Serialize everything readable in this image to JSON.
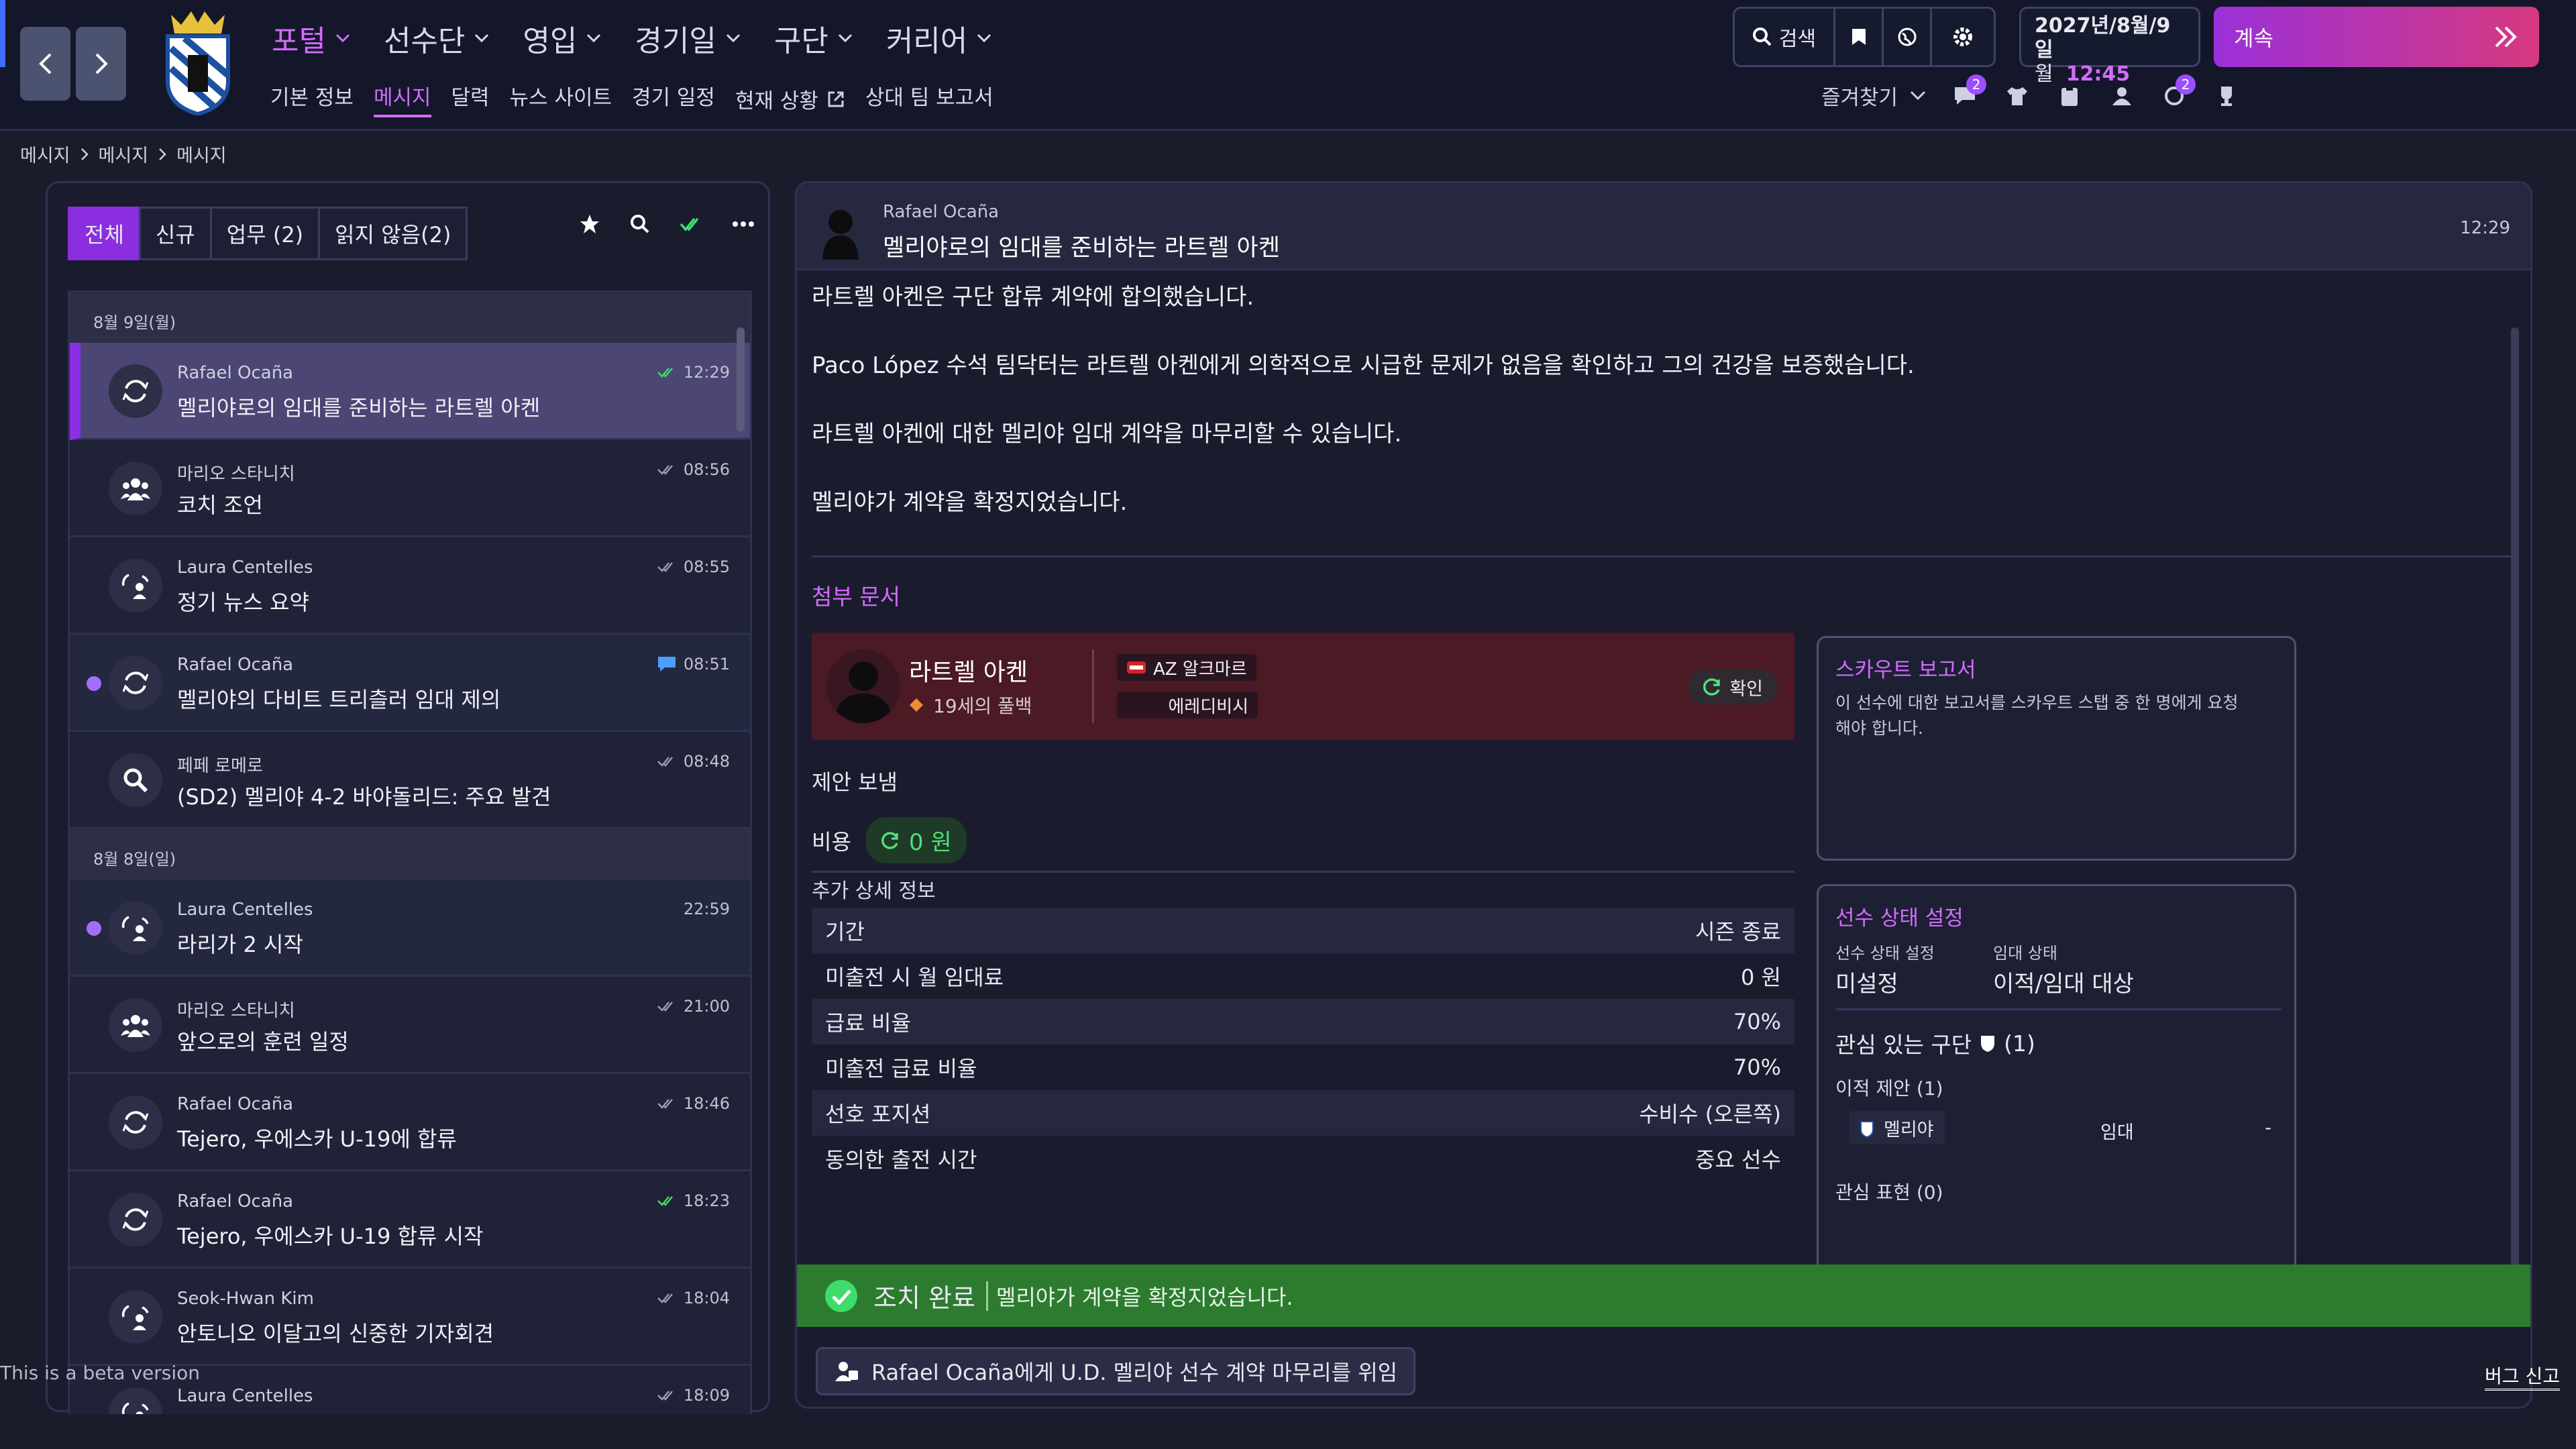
{
  "topbar": {
    "menu": [
      {
        "label": "포털",
        "active": true
      },
      {
        "label": "선수단"
      },
      {
        "label": "영입"
      },
      {
        "label": "경기일"
      },
      {
        "label": "구단"
      },
      {
        "label": "커리어"
      }
    ],
    "submenu": [
      "기본 정보",
      "메시지",
      "달력",
      "뉴스 사이트",
      "경기 일정",
      "현재 상황",
      "상대 팀 보고서"
    ],
    "submenu_active": "메시지",
    "search_label": "검색",
    "date_line1": "2027년/8월/9일",
    "date_weekday": "월",
    "date_time": "12:45",
    "continue_label": "계속",
    "favorites_label": "즐겨찾기",
    "badges": {
      "chat": "2",
      "board": "2"
    }
  },
  "breadcrumb": [
    "메시지",
    "메시지",
    "메시지"
  ],
  "inbox": {
    "tabs": [
      "전체",
      "신규",
      "업무 (2)",
      "읽지 않음(2)"
    ],
    "groups": [
      {
        "date": "8월 9일(월)",
        "messages": [
          {
            "sender": "Rafael Ocaña",
            "subject": "멜리야로의 임대를 준비하는 라트렐 아켄",
            "time": "12:29",
            "status": "read-green",
            "avatar": "transfer-icon",
            "selected": true
          },
          {
            "sender": "마리오 스타니치",
            "subject": "코치 조언",
            "time": "08:56",
            "status": "read",
            "avatar": "staff-group-icon"
          },
          {
            "sender": "Laura Centelles",
            "subject": "정기 뉴스 요약",
            "time": "08:55",
            "status": "read",
            "avatar": "people-exchange-icon"
          },
          {
            "sender": "Rafael Ocaña",
            "subject": "멜리야의 다비트 트리츨러 임대 제의",
            "time": "08:51",
            "status": "chat",
            "avatar": "transfer-icon",
            "unread": true
          },
          {
            "sender": "페페 로메로",
            "subject": "(SD2) 멜리야 4-2 바야돌리드: 주요 발견",
            "time": "08:48",
            "status": "read",
            "avatar": "magnifier-icon"
          }
        ]
      },
      {
        "date": "8월 8일(일)",
        "messages": [
          {
            "sender": "Laura Centelles",
            "subject": "라리가 2 시작",
            "time": "22:59",
            "status": "none",
            "avatar": "people-exchange-icon",
            "unread": true
          },
          {
            "sender": "마리오 스타니치",
            "subject": "앞으로의 훈련 일정",
            "time": "21:00",
            "status": "read",
            "avatar": "staff-group-icon"
          },
          {
            "sender": "Rafael Ocaña",
            "subject": "Tejero, 우에스카 U-19에 합류",
            "time": "18:46",
            "status": "read",
            "avatar": "transfer-icon"
          },
          {
            "sender": "Rafael Ocaña",
            "subject": "Tejero, 우에스카 U-19 합류 시작",
            "time": "18:23",
            "status": "read-green",
            "avatar": "transfer-icon"
          },
          {
            "sender": "Seok-Hwan Kim",
            "subject": "안토니오 이달고의 신중한 기자회견",
            "time": "18:04",
            "status": "read",
            "avatar": "people-exchange-icon"
          },
          {
            "sender": "Laura Centelles",
            "subject": "",
            "time": "18:09",
            "status": "read",
            "avatar": "people-exchange-icon"
          }
        ]
      }
    ]
  },
  "message": {
    "sender": "Rafael Ocaña",
    "title": "멜리야로의 임대를 준비하는 라트렐 아켄",
    "time": "12:29",
    "paragraphs": [
      "라트렐 아켄은 구단 합류 계약에 합의했습니다.",
      "Paco López 수석 팀닥터는 라트렐 아켄에게 의학적으로 시급한 문제가 없음을 확인하고 그의 건강을 보증했습니다.",
      "라트렐 아켄에 대한 멜리야 임대 계약을 마무리할 수 있습니다.",
      "멜리야가 계약을 확정지었습니다."
    ],
    "attachments_title": "첨부 문서",
    "player": {
      "name": "라트렐 아켄",
      "desc": "19세의 풀백",
      "club": "AZ 알크마르",
      "club2": "에레디비시",
      "confirm": "확인"
    },
    "offer_label": "제안 보냄",
    "fee_label": "비용",
    "fee_value": "0 원",
    "details_title": "추가 상세 정보",
    "details": [
      {
        "k": "기간",
        "v": "시즌 종료"
      },
      {
        "k": "미출전 시 월 임대료",
        "v": "0 원"
      },
      {
        "k": "급료 비율",
        "v": "70%"
      },
      {
        "k": "미출전 급료 비율",
        "v": "70%"
      },
      {
        "k": "선호 포지션",
        "v": "수비수 (오른쪽)"
      },
      {
        "k": "동의한 출전 시간",
        "v": "중요 선수"
      }
    ],
    "scout": {
      "title": "스카우트 보고서",
      "text": "이 선수에 대한 보고서를 스카우트 스탭 중 한 명에게 요청해야 합니다."
    },
    "status": {
      "title": "선수 상태 설정",
      "label1": "선수 상태 설정",
      "value1": "미설정",
      "label2": "임대 상태",
      "value2": "이적/임대 대상",
      "interest": "관심 있는 구단",
      "interest_count": "(1)",
      "offers": "이적 제안 (1)",
      "offer_club": "멜리야",
      "offer_type": "임대",
      "offer_dash": "-",
      "express": "관심 표현 (0)"
    },
    "done_label": "조치 완료",
    "done_text": "멜리야가 계약을 확정지었습니다.",
    "delegate": "Rafael Ocaña에게 U.D. 멜리야 선수 계약 마무리를 위임"
  },
  "footer": {
    "beta": "This is a beta version",
    "bug": "버그 신고"
  },
  "colors": {
    "accent": "#d36bff",
    "selected": "#8b2fe6",
    "success": "#2c7b2f",
    "green": "#3ddc6b"
  }
}
